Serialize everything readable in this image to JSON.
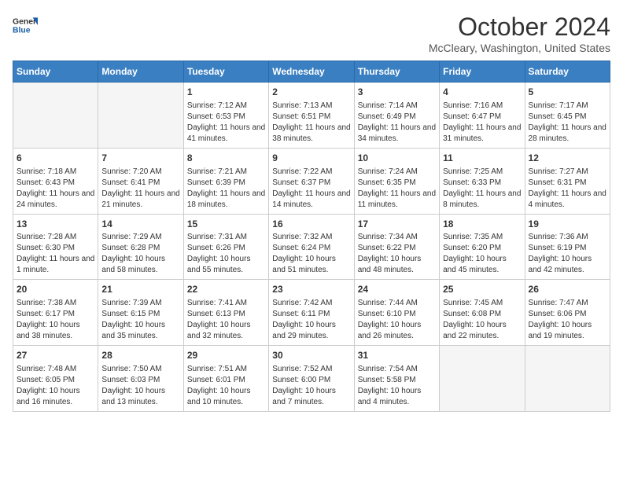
{
  "header": {
    "logo_line1": "General",
    "logo_line2": "Blue",
    "month": "October 2024",
    "location": "McCleary, Washington, United States"
  },
  "weekdays": [
    "Sunday",
    "Monday",
    "Tuesday",
    "Wednesday",
    "Thursday",
    "Friday",
    "Saturday"
  ],
  "weeks": [
    [
      {
        "day": "",
        "empty": true
      },
      {
        "day": "",
        "empty": true
      },
      {
        "day": "1",
        "sunrise": "7:12 AM",
        "sunset": "6:53 PM",
        "daylight": "11 hours and 41 minutes."
      },
      {
        "day": "2",
        "sunrise": "7:13 AM",
        "sunset": "6:51 PM",
        "daylight": "11 hours and 38 minutes."
      },
      {
        "day": "3",
        "sunrise": "7:14 AM",
        "sunset": "6:49 PM",
        "daylight": "11 hours and 34 minutes."
      },
      {
        "day": "4",
        "sunrise": "7:16 AM",
        "sunset": "6:47 PM",
        "daylight": "11 hours and 31 minutes."
      },
      {
        "day": "5",
        "sunrise": "7:17 AM",
        "sunset": "6:45 PM",
        "daylight": "11 hours and 28 minutes."
      }
    ],
    [
      {
        "day": "6",
        "sunrise": "7:18 AM",
        "sunset": "6:43 PM",
        "daylight": "11 hours and 24 minutes."
      },
      {
        "day": "7",
        "sunrise": "7:20 AM",
        "sunset": "6:41 PM",
        "daylight": "11 hours and 21 minutes."
      },
      {
        "day": "8",
        "sunrise": "7:21 AM",
        "sunset": "6:39 PM",
        "daylight": "11 hours and 18 minutes."
      },
      {
        "day": "9",
        "sunrise": "7:22 AM",
        "sunset": "6:37 PM",
        "daylight": "11 hours and 14 minutes."
      },
      {
        "day": "10",
        "sunrise": "7:24 AM",
        "sunset": "6:35 PM",
        "daylight": "11 hours and 11 minutes."
      },
      {
        "day": "11",
        "sunrise": "7:25 AM",
        "sunset": "6:33 PM",
        "daylight": "11 hours and 8 minutes."
      },
      {
        "day": "12",
        "sunrise": "7:27 AM",
        "sunset": "6:31 PM",
        "daylight": "11 hours and 4 minutes."
      }
    ],
    [
      {
        "day": "13",
        "sunrise": "7:28 AM",
        "sunset": "6:30 PM",
        "daylight": "11 hours and 1 minute."
      },
      {
        "day": "14",
        "sunrise": "7:29 AM",
        "sunset": "6:28 PM",
        "daylight": "10 hours and 58 minutes."
      },
      {
        "day": "15",
        "sunrise": "7:31 AM",
        "sunset": "6:26 PM",
        "daylight": "10 hours and 55 minutes."
      },
      {
        "day": "16",
        "sunrise": "7:32 AM",
        "sunset": "6:24 PM",
        "daylight": "10 hours and 51 minutes."
      },
      {
        "day": "17",
        "sunrise": "7:34 AM",
        "sunset": "6:22 PM",
        "daylight": "10 hours and 48 minutes."
      },
      {
        "day": "18",
        "sunrise": "7:35 AM",
        "sunset": "6:20 PM",
        "daylight": "10 hours and 45 minutes."
      },
      {
        "day": "19",
        "sunrise": "7:36 AM",
        "sunset": "6:19 PM",
        "daylight": "10 hours and 42 minutes."
      }
    ],
    [
      {
        "day": "20",
        "sunrise": "7:38 AM",
        "sunset": "6:17 PM",
        "daylight": "10 hours and 38 minutes."
      },
      {
        "day": "21",
        "sunrise": "7:39 AM",
        "sunset": "6:15 PM",
        "daylight": "10 hours and 35 minutes."
      },
      {
        "day": "22",
        "sunrise": "7:41 AM",
        "sunset": "6:13 PM",
        "daylight": "10 hours and 32 minutes."
      },
      {
        "day": "23",
        "sunrise": "7:42 AM",
        "sunset": "6:11 PM",
        "daylight": "10 hours and 29 minutes."
      },
      {
        "day": "24",
        "sunrise": "7:44 AM",
        "sunset": "6:10 PM",
        "daylight": "10 hours and 26 minutes."
      },
      {
        "day": "25",
        "sunrise": "7:45 AM",
        "sunset": "6:08 PM",
        "daylight": "10 hours and 22 minutes."
      },
      {
        "day": "26",
        "sunrise": "7:47 AM",
        "sunset": "6:06 PM",
        "daylight": "10 hours and 19 minutes."
      }
    ],
    [
      {
        "day": "27",
        "sunrise": "7:48 AM",
        "sunset": "6:05 PM",
        "daylight": "10 hours and 16 minutes."
      },
      {
        "day": "28",
        "sunrise": "7:50 AM",
        "sunset": "6:03 PM",
        "daylight": "10 hours and 13 minutes."
      },
      {
        "day": "29",
        "sunrise": "7:51 AM",
        "sunset": "6:01 PM",
        "daylight": "10 hours and 10 minutes."
      },
      {
        "day": "30",
        "sunrise": "7:52 AM",
        "sunset": "6:00 PM",
        "daylight": "10 hours and 7 minutes."
      },
      {
        "day": "31",
        "sunrise": "7:54 AM",
        "sunset": "5:58 PM",
        "daylight": "10 hours and 4 minutes."
      },
      {
        "day": "",
        "empty": true
      },
      {
        "day": "",
        "empty": true
      }
    ]
  ]
}
